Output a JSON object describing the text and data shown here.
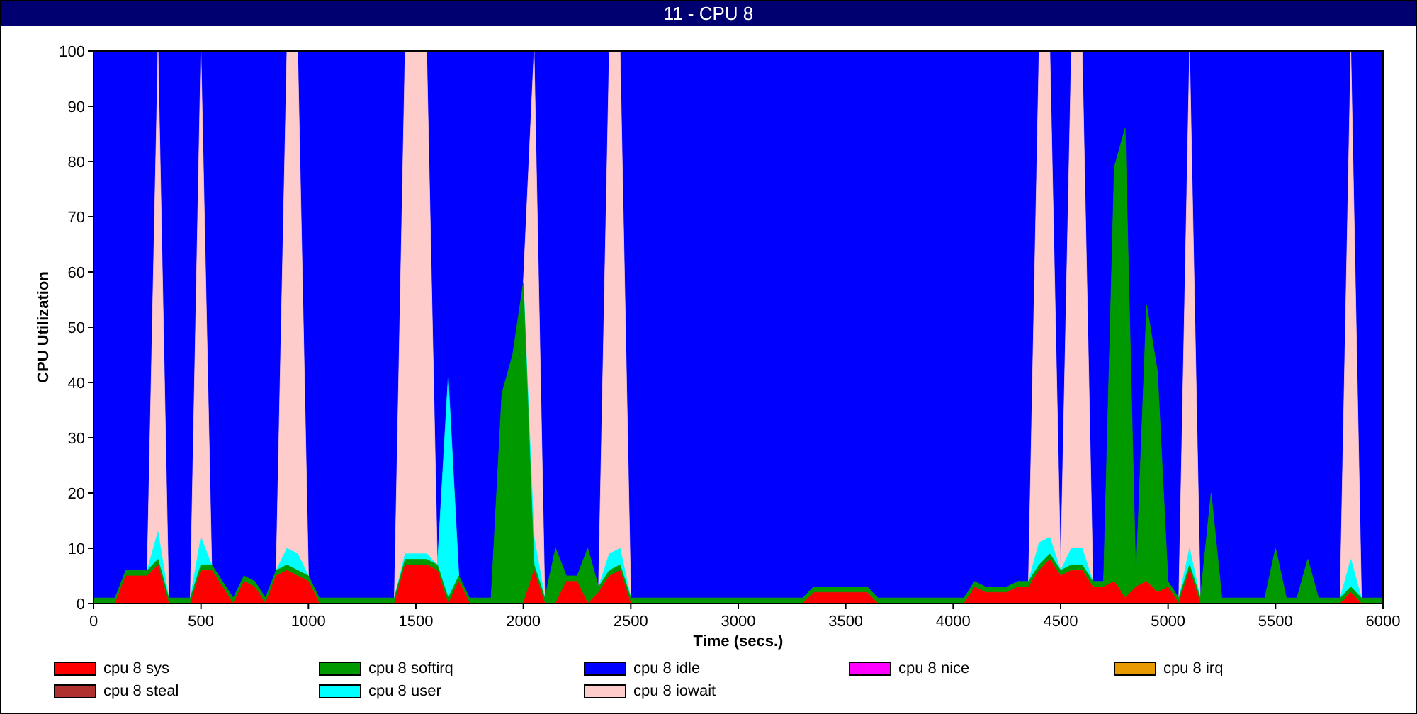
{
  "window": {
    "title": "11 - CPU 8"
  },
  "chart": {
    "chart_data": {
      "type": "area",
      "stacked": true,
      "xlabel": "Time (secs.)",
      "ylabel": "CPU Utilization",
      "xlim": [
        0,
        6000
      ],
      "ylim": [
        0,
        100
      ],
      "xticks": [
        0,
        500,
        1000,
        1500,
        2000,
        2500,
        3000,
        3500,
        4000,
        4500,
        5000,
        5500,
        6000
      ],
      "yticks": [
        0,
        10,
        20,
        30,
        40,
        50,
        60,
        70,
        80,
        90,
        100
      ],
      "x": [
        0,
        50,
        100,
        150,
        200,
        250,
        300,
        350,
        400,
        450,
        500,
        550,
        600,
        650,
        700,
        750,
        800,
        850,
        900,
        950,
        1000,
        1050,
        1100,
        1150,
        1200,
        1250,
        1300,
        1350,
        1400,
        1450,
        1500,
        1550,
        1600,
        1650,
        1700,
        1750,
        1800,
        1850,
        1900,
        1950,
        2000,
        2050,
        2100,
        2150,
        2200,
        2250,
        2300,
        2350,
        2400,
        2450,
        2500,
        2550,
        2600,
        2650,
        2700,
        2750,
        2800,
        2850,
        2900,
        2950,
        3000,
        3050,
        3100,
        3150,
        3200,
        3250,
        3300,
        3350,
        3400,
        3450,
        3500,
        3550,
        3600,
        3650,
        3700,
        3750,
        3800,
        3850,
        3900,
        3950,
        4000,
        4050,
        4100,
        4150,
        4200,
        4250,
        4300,
        4350,
        4400,
        4450,
        4500,
        4550,
        4600,
        4650,
        4700,
        4750,
        4800,
        4850,
        4900,
        4950,
        5000,
        5050,
        5100,
        5150,
        5200,
        5250,
        5300,
        5350,
        5400,
        5450,
        5500,
        5550,
        5600,
        5650,
        5700,
        5750,
        5800,
        5850,
        5900,
        5950,
        6000
      ],
      "series": [
        {
          "name": "cpu 8 sys",
          "color": "#ff0000",
          "values": [
            0,
            0,
            0,
            5,
            5,
            5,
            7,
            0,
            0,
            0,
            6,
            6,
            3,
            0,
            4,
            3,
            0,
            5,
            6,
            5,
            4,
            0,
            0,
            0,
            0,
            0,
            0,
            0,
            0,
            7,
            7,
            7,
            6,
            0,
            4,
            0,
            0,
            0,
            0,
            0,
            0,
            6,
            0,
            0,
            4,
            4,
            0,
            2,
            5,
            6,
            0,
            0,
            0,
            0,
            0,
            0,
            0,
            0,
            0,
            0,
            0,
            0,
            0,
            0,
            0,
            0,
            0,
            2,
            2,
            2,
            2,
            2,
            2,
            0,
            0,
            0,
            0,
            0,
            0,
            0,
            0,
            0,
            3,
            2,
            2,
            2,
            3,
            3,
            6,
            8,
            5,
            6,
            6,
            3,
            3,
            4,
            1,
            3,
            4,
            2,
            3,
            0,
            6,
            0,
            0,
            0,
            0,
            0,
            0,
            0,
            0,
            0,
            0,
            0,
            0,
            0,
            0,
            2,
            0,
            0,
            0
          ]
        },
        {
          "name": "cpu 8 softirq",
          "color": "#009900",
          "values": [
            1,
            1,
            1,
            1,
            1,
            1,
            1,
            1,
            1,
            1,
            1,
            1,
            1,
            1,
            1,
            1,
            1,
            1,
            1,
            1,
            1,
            1,
            1,
            1,
            1,
            1,
            1,
            1,
            1,
            1,
            1,
            1,
            1,
            1,
            1,
            1,
            1,
            1,
            38,
            45,
            58,
            1,
            1,
            10,
            1,
            1,
            10,
            1,
            1,
            1,
            1,
            1,
            1,
            1,
            1,
            1,
            1,
            1,
            1,
            1,
            1,
            1,
            1,
            1,
            1,
            1,
            1,
            1,
            1,
            1,
            1,
            1,
            1,
            1,
            1,
            1,
            1,
            1,
            1,
            1,
            1,
            1,
            1,
            1,
            1,
            1,
            1,
            1,
            1,
            1,
            1,
            1,
            1,
            1,
            1,
            75,
            85,
            1,
            50,
            40,
            1,
            1,
            1,
            1,
            20,
            1,
            1,
            1,
            1,
            1,
            10,
            1,
            1,
            8,
            1,
            1,
            1,
            1,
            1,
            1,
            1
          ]
        },
        {
          "name": "cpu 8 nice",
          "color": "#ff00ff",
          "values": [
            null,
            null,
            null,
            null,
            null,
            null,
            null,
            null,
            null,
            null,
            null,
            null,
            null,
            null,
            null,
            null,
            null,
            null,
            null,
            null,
            null,
            null,
            null,
            null,
            null,
            null,
            null,
            null,
            null,
            null,
            null,
            null,
            null,
            null,
            null,
            null,
            null,
            null,
            null,
            null,
            null,
            null,
            null,
            null,
            null,
            null,
            null,
            null,
            null,
            null,
            null,
            null,
            null,
            null,
            null,
            null,
            null,
            null,
            null,
            null,
            null,
            null,
            null,
            null,
            null,
            null,
            null,
            null,
            null,
            null,
            null,
            null,
            null,
            null,
            null,
            null,
            null,
            null,
            null,
            null,
            null,
            null,
            null,
            null,
            null,
            null,
            null,
            null,
            null,
            null,
            null,
            null,
            null,
            null,
            null,
            null,
            null,
            null,
            null,
            null,
            null,
            null,
            null,
            null,
            null,
            null,
            null,
            null,
            null,
            null,
            null,
            null,
            null,
            null,
            null,
            null,
            null,
            null,
            null,
            null,
            null
          ]
        },
        {
          "name": "cpu 8 irq",
          "color": "#e69900",
          "values": [
            null,
            null,
            null,
            null,
            null,
            null,
            null,
            null,
            null,
            null,
            null,
            null,
            null,
            null,
            null,
            null,
            null,
            null,
            null,
            null,
            null,
            null,
            null,
            null,
            null,
            null,
            null,
            null,
            null,
            null,
            null,
            null,
            null,
            null,
            null,
            null,
            null,
            null,
            null,
            null,
            null,
            null,
            null,
            null,
            null,
            null,
            null,
            null,
            null,
            null,
            null,
            null,
            null,
            null,
            null,
            null,
            null,
            null,
            null,
            null,
            null,
            null,
            null,
            null,
            null,
            null,
            null,
            null,
            null,
            null,
            null,
            null,
            null,
            null,
            null,
            null,
            null,
            null,
            null,
            null,
            null,
            null,
            null,
            null,
            null,
            null,
            null,
            null,
            null,
            null,
            null,
            null,
            null,
            null,
            null,
            null,
            null,
            null,
            null,
            null,
            null,
            null,
            null,
            null,
            null,
            null,
            null,
            null,
            null,
            null,
            null,
            null,
            null,
            null,
            null,
            null,
            null,
            null,
            null,
            null,
            null
          ]
        },
        {
          "name": "cpu 8 steal",
          "color": "#b03030",
          "values": [
            null,
            null,
            null,
            null,
            null,
            null,
            null,
            null,
            null,
            null,
            null,
            null,
            null,
            null,
            null,
            null,
            null,
            null,
            null,
            null,
            null,
            null,
            null,
            null,
            null,
            null,
            null,
            null,
            null,
            null,
            null,
            null,
            null,
            null,
            null,
            null,
            null,
            null,
            null,
            null,
            null,
            null,
            null,
            null,
            null,
            null,
            null,
            null,
            null,
            null,
            null,
            null,
            null,
            null,
            null,
            null,
            null,
            null,
            null,
            null,
            null,
            null,
            null,
            null,
            null,
            null,
            null,
            null,
            null,
            null,
            null,
            null,
            null,
            null,
            null,
            null,
            null,
            null,
            null,
            null,
            null,
            null,
            null,
            null,
            null,
            null,
            null,
            null,
            null,
            null,
            null,
            null,
            null,
            null,
            null,
            null,
            null,
            null,
            null,
            null,
            null,
            null,
            null,
            null,
            null,
            null,
            null,
            null,
            null,
            null,
            null,
            null,
            null,
            null,
            null,
            null,
            null,
            null,
            null,
            null,
            null
          ]
        },
        {
          "name": "cpu 8 user",
          "color": "#00ffff",
          "values": [
            null,
            null,
            null,
            null,
            null,
            0,
            5,
            0,
            null,
            0,
            5,
            0,
            null,
            null,
            null,
            null,
            null,
            0,
            3,
            3,
            0,
            null,
            null,
            null,
            null,
            null,
            null,
            null,
            0,
            1,
            1,
            1,
            0,
            40,
            0,
            null,
            null,
            null,
            null,
            null,
            0,
            5,
            0,
            null,
            null,
            null,
            null,
            0,
            3,
            3,
            0,
            null,
            null,
            null,
            null,
            null,
            null,
            null,
            null,
            null,
            null,
            null,
            null,
            null,
            null,
            null,
            null,
            null,
            null,
            null,
            null,
            null,
            null,
            null,
            null,
            null,
            null,
            null,
            null,
            null,
            null,
            null,
            null,
            null,
            null,
            null,
            null,
            0,
            4,
            3,
            0,
            3,
            3,
            0,
            null,
            null,
            null,
            null,
            null,
            null,
            null,
            0,
            3,
            0,
            null,
            null,
            null,
            null,
            null,
            null,
            null,
            null,
            null,
            null,
            null,
            null,
            0,
            5,
            0,
            null,
            null
          ]
        },
        {
          "name": "cpu 8 iowait",
          "color": "#ffcccc",
          "values": [
            null,
            null,
            null,
            null,
            null,
            0,
            87,
            0,
            null,
            0,
            88,
            0,
            null,
            null,
            null,
            null,
            null,
            0,
            90,
            91,
            0,
            null,
            null,
            null,
            null,
            null,
            null,
            null,
            0,
            91,
            91,
            91,
            0,
            null,
            null,
            null,
            null,
            null,
            null,
            null,
            0,
            88,
            0,
            null,
            null,
            null,
            null,
            0,
            91,
            90,
            0,
            null,
            null,
            null,
            null,
            null,
            null,
            null,
            null,
            null,
            null,
            null,
            null,
            null,
            null,
            null,
            null,
            null,
            null,
            null,
            null,
            null,
            null,
            null,
            null,
            null,
            null,
            null,
            null,
            null,
            null,
            null,
            null,
            null,
            null,
            null,
            null,
            0,
            89,
            88,
            0,
            90,
            90,
            0,
            null,
            null,
            null,
            null,
            null,
            null,
            null,
            0,
            90,
            0,
            null,
            null,
            null,
            null,
            null,
            null,
            null,
            null,
            null,
            null,
            null,
            null,
            0,
            92,
            0,
            null,
            null
          ]
        },
        {
          "name": "cpu 8 idle",
          "color": "#0000ff",
          "values": [
            99,
            99,
            99,
            94,
            94,
            94,
            0,
            99,
            99,
            99,
            0,
            93,
            96,
            99,
            95,
            96,
            99,
            94,
            0,
            0,
            95,
            99,
            99,
            99,
            99,
            99,
            99,
            99,
            99,
            0,
            0,
            0,
            93,
            59,
            95,
            99,
            99,
            99,
            62,
            55,
            42,
            0,
            99,
            90,
            95,
            95,
            90,
            97,
            0,
            0,
            99,
            99,
            99,
            99,
            99,
            99,
            99,
            99,
            99,
            99,
            99,
            99,
            99,
            99,
            99,
            99,
            99,
            97,
            97,
            97,
            97,
            97,
            97,
            99,
            99,
            99,
            99,
            99,
            99,
            99,
            99,
            99,
            96,
            97,
            97,
            97,
            96,
            96,
            0,
            0,
            94,
            0,
            0,
            96,
            96,
            21,
            14,
            96,
            46,
            58,
            96,
            99,
            0,
            99,
            80,
            99,
            99,
            99,
            99,
            99,
            90,
            99,
            99,
            92,
            99,
            99,
            99,
            0,
            99,
            99,
            99
          ]
        }
      ]
    }
  }
}
